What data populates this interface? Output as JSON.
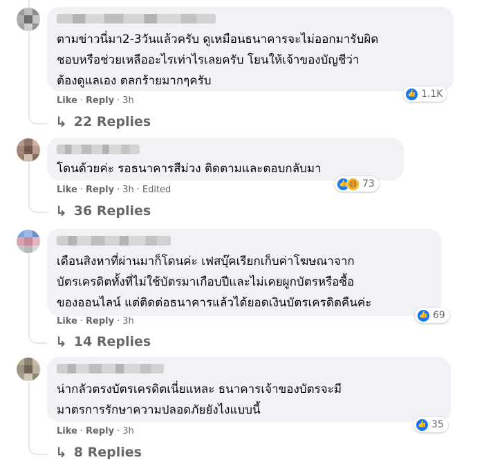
{
  "comments": [
    {
      "text": "ตามข่าวนี่มา2-3วันแล้วครับ ดูเหมือนธนาคารจะไม่ออกมารับผิด\nชอบหรือช่วยเหลืออะไรเท่าไรเลยครับ โยนให้เจ้าของบัญชีว่า\nต้องดูแลเอง ตลกร้ายมากๆครับ",
      "reaction_count": "1.1K",
      "like_label": "Like",
      "reply_label": "Reply",
      "time": "3h",
      "edited": "",
      "replies_label": "22 Replies",
      "reactions": [
        "like-icon"
      ]
    },
    {
      "text": "โดนด้วยค่ะ รอธนาคารสีม่วง ติดตามและตอบกลับมา",
      "reaction_count": "73",
      "like_label": "Like",
      "reply_label": "Reply",
      "time": "3h",
      "edited": "Edited",
      "replies_label": "36 Replies",
      "reactions": [
        "like-icon",
        "sad-icon"
      ]
    },
    {
      "text": "เดือนสิงหาที่ผ่านมาก็โดนค่ะ เฟสบุ๊คเรียกเก็บค่าโฆษณาจาก\nบัตรเครดิตทั้งที่ไม่ใช้บัตรมาเกือบปีและไม่เคยผูกบัตรหรือซื้อ\nของออนไลน์ แต่ติดต่อธนาคารแล้วได้ยอดเงินบัตรเครดิตคืนค่ะ",
      "reaction_count": "69",
      "like_label": "Like",
      "reply_label": "Reply",
      "time": "3h",
      "edited": "",
      "replies_label": "14 Replies",
      "reactions": [
        "like-icon"
      ]
    },
    {
      "text": "น่ากลัวตรงบัตรเครดิตเนี่ยแหละ ธนาคารเจ้าของบัตรจะมี\nมาตรการรักษาความปลอดภัยยังไงแบบนี้",
      "reaction_count": "35",
      "like_label": "Like",
      "reply_label": "Reply",
      "time": "3h",
      "edited": "",
      "replies_label": "8 Replies",
      "reactions": [
        "like-icon"
      ]
    }
  ],
  "colors": {
    "bubble": "#f0f2f5",
    "like_blue": "#1877f2",
    "sad_yellow": "#f7b125",
    "meta_gray": "#65676b"
  }
}
